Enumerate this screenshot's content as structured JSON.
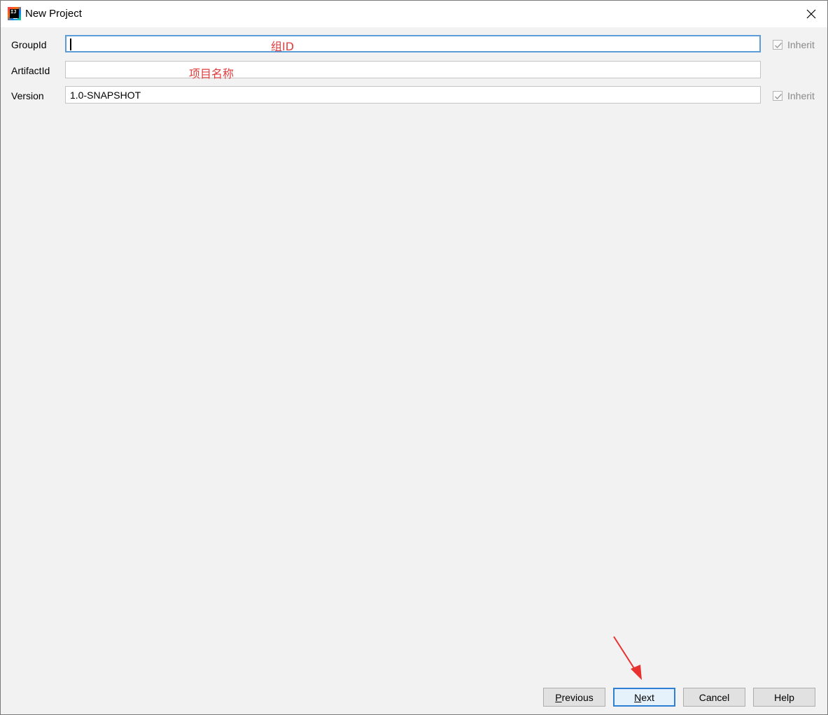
{
  "window": {
    "title": "New Project",
    "close_symbol": "×"
  },
  "form": {
    "group_id": {
      "label": "GroupId",
      "value": "",
      "inherit_label": "Inherit",
      "inherit_checked": true
    },
    "artifact_id": {
      "label": "ArtifactId",
      "value": ""
    },
    "version": {
      "label": "Version",
      "value": "1.0-SNAPSHOT",
      "inherit_label": "Inherit",
      "inherit_checked": true
    }
  },
  "annotations": {
    "group_id_note": "组ID",
    "artifact_id_note": "项目名称"
  },
  "buttons": {
    "previous": {
      "mnemonic": "P",
      "rest": "revious"
    },
    "next": {
      "mnemonic": "N",
      "rest": "ext"
    },
    "cancel": "Cancel",
    "help": "Help"
  },
  "icons": {
    "app": "intellij-idea-icon",
    "close": "close-icon",
    "check": "check-icon",
    "pointer": "red-arrow-annotation"
  },
  "colors": {
    "annotation": "#e03c3c",
    "focus_border": "#5b9dd9",
    "default_button_border": "#2e7fd6",
    "background": "#f2f2f2"
  }
}
